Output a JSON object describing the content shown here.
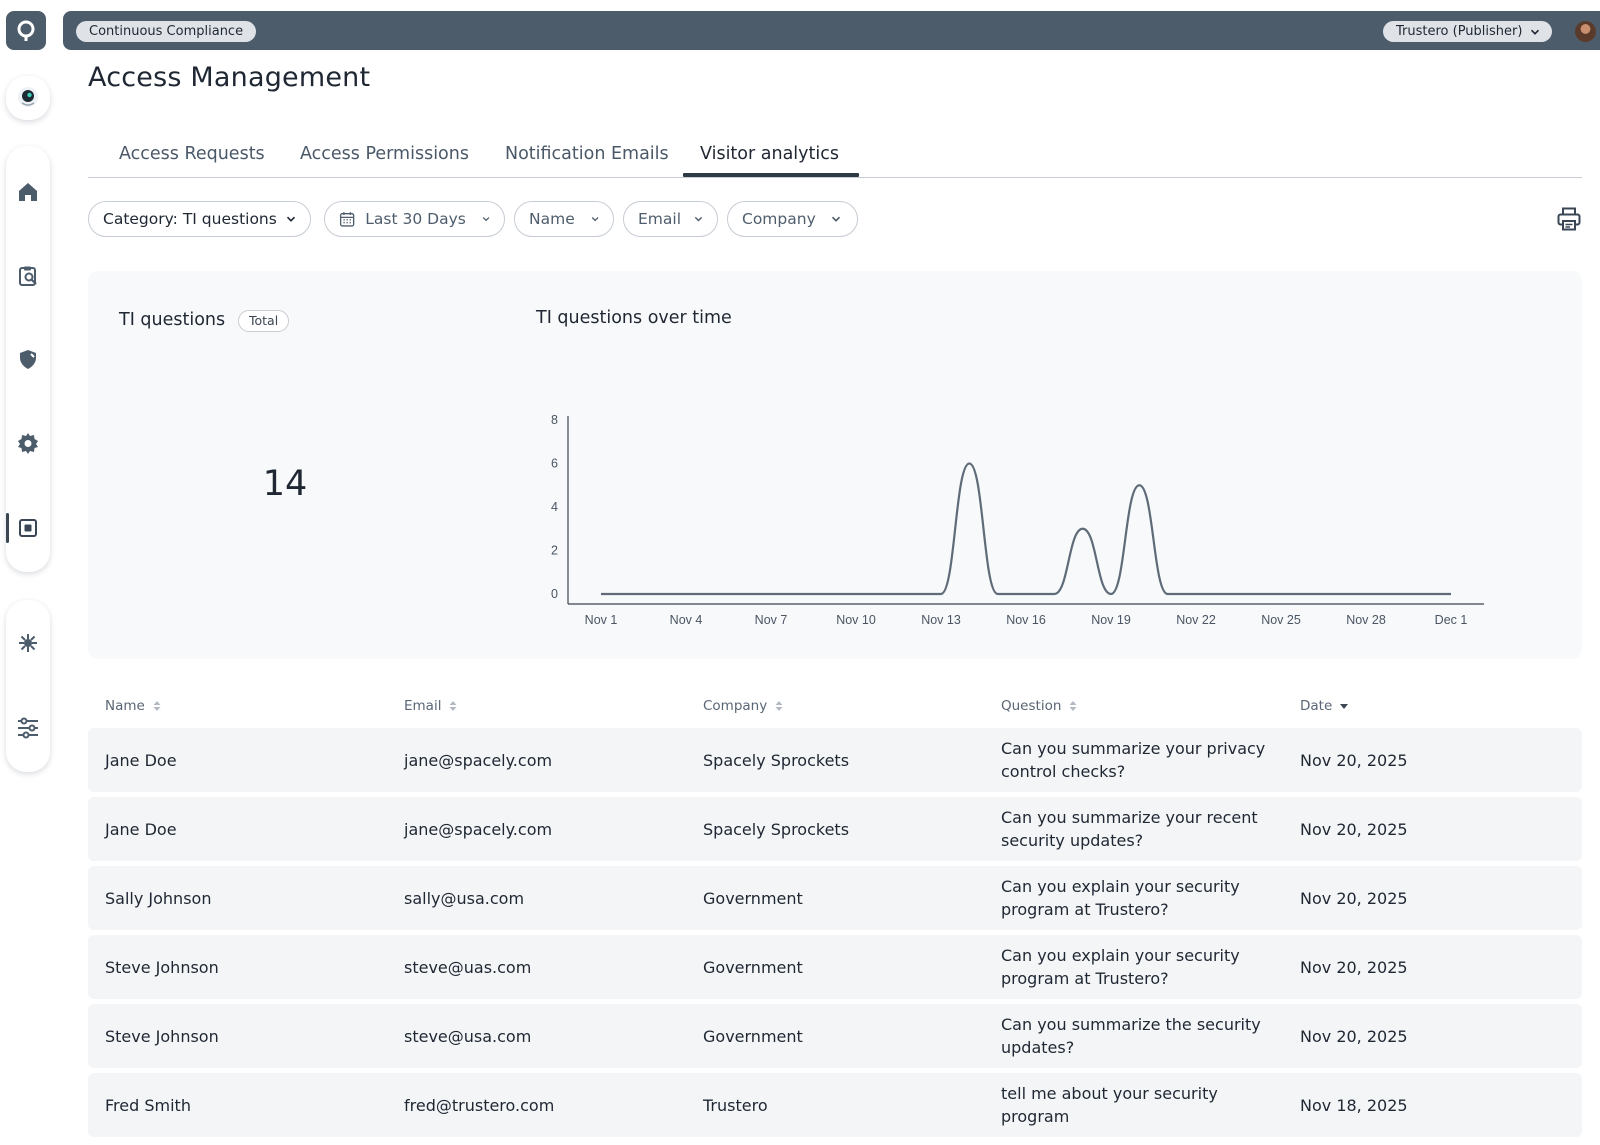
{
  "topbar": {
    "workspace": "Continuous Compliance",
    "account": "Trustero (Publisher)"
  },
  "sidebar": {
    "icons": [
      "assistant-icon",
      "home-icon",
      "clipboard-search-icon",
      "shield-icon",
      "gear-icon",
      "trust-center-icon",
      "integrations-icon",
      "settings-sliders-icon"
    ],
    "active": "trust-center-icon"
  },
  "page": {
    "title": "Access Management"
  },
  "tabs": [
    {
      "label": "Access Requests",
      "active": false
    },
    {
      "label": "Access Permissions",
      "active": false
    },
    {
      "label": "Notification Emails",
      "active": false
    },
    {
      "label": "Visitor analytics",
      "active": true
    }
  ],
  "filters": {
    "category": "Category: TI questions",
    "date_range": "Last 30 Days",
    "name": "Name",
    "email": "Email",
    "company": "Company"
  },
  "stat": {
    "label": "TI questions",
    "badge": "Total",
    "value": "14"
  },
  "chart_title": "TI questions over time",
  "chart_data": {
    "type": "line",
    "title": "TI questions over time",
    "xlabel": "",
    "ylabel": "",
    "ylim": [
      0,
      8
    ],
    "y_ticks": [
      "0",
      "2",
      "4",
      "6",
      "8"
    ],
    "x_tick_labels": [
      "Nov 1",
      "Nov 4",
      "Nov 7",
      "Nov 10",
      "Nov 13",
      "Nov 16",
      "Nov 19",
      "Nov 22",
      "Nov 25",
      "Nov 28",
      "Dec 1"
    ],
    "x": [
      "Nov 1",
      "Nov 2",
      "Nov 3",
      "Nov 4",
      "Nov 5",
      "Nov 6",
      "Nov 7",
      "Nov 8",
      "Nov 9",
      "Nov 10",
      "Nov 11",
      "Nov 12",
      "Nov 13",
      "Nov 14",
      "Nov 15",
      "Nov 16",
      "Nov 17",
      "Nov 18",
      "Nov 19",
      "Nov 20",
      "Nov 21",
      "Nov 22",
      "Nov 23",
      "Nov 24",
      "Nov 25",
      "Nov 26",
      "Nov 27",
      "Nov 28",
      "Nov 29",
      "Nov 30",
      "Dec 1"
    ],
    "series": [
      {
        "values": [
          0,
          0,
          0,
          0,
          0,
          0,
          0,
          0,
          0,
          0,
          0,
          0,
          0,
          6,
          0,
          0,
          0,
          3,
          0,
          5,
          0,
          0,
          0,
          0,
          0,
          0,
          0,
          0,
          0,
          0,
          0
        ]
      }
    ],
    "grid": false,
    "color": "#5f6b79"
  },
  "table": {
    "columns": [
      {
        "label": "Name",
        "sort": "none"
      },
      {
        "label": "Email",
        "sort": "none"
      },
      {
        "label": "Company",
        "sort": "none"
      },
      {
        "label": "Question",
        "sort": "none"
      },
      {
        "label": "Date",
        "sort": "desc"
      }
    ],
    "rows": [
      {
        "name": "Jane Doe",
        "email": "jane@spacely.com",
        "company": "Spacely Sprockets",
        "question": "Can you summarize your privacy control checks?",
        "date": "Nov 20, 2025"
      },
      {
        "name": "Jane Doe",
        "email": "jane@spacely.com",
        "company": "Spacely Sprockets",
        "question": "Can you summarize your recent security updates?",
        "date": "Nov 20, 2025"
      },
      {
        "name": "Sally Johnson",
        "email": "sally@usa.com",
        "company": "Government",
        "question": "Can you explain your security program at Trustero?",
        "date": "Nov 20, 2025"
      },
      {
        "name": "Steve Johnson",
        "email": "steve@uas.com",
        "company": "Government",
        "question": "Can you explain your security program at Trustero?",
        "date": "Nov 20, 2025"
      },
      {
        "name": "Steve Johnson",
        "email": "steve@usa.com",
        "company": "Government",
        "question": "Can you summarize the security updates?",
        "date": "Nov 20, 2025"
      },
      {
        "name": "Fred Smith",
        "email": "fred@trustero.com",
        "company": "Trustero",
        "question": "tell me about your security program",
        "date": "Nov 18, 2025"
      }
    ]
  }
}
